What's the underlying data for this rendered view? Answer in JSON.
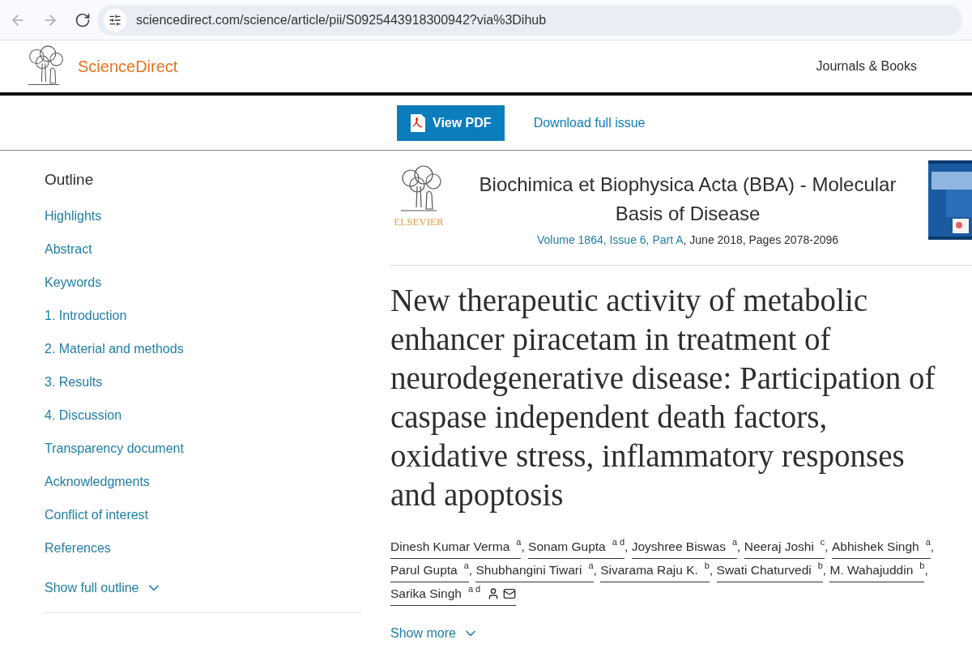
{
  "browser": {
    "url": "sciencedirect.com/science/article/pii/S0925443918300942?via%3Dihub"
  },
  "header": {
    "logo_text": "ScienceDirect",
    "nav": "Journals & Books"
  },
  "toolbar": {
    "pdf_button": "View PDF",
    "download": "Download full issue"
  },
  "outline": {
    "title": "Outline",
    "items": [
      "Highlights",
      "Abstract",
      "Keywords",
      "1. Introduction",
      "2. Material and methods",
      "3. Results",
      "4. Discussion",
      "Transparency document",
      "Acknowledgments",
      "Conflict of interest",
      "References"
    ],
    "show_full": "Show full outline"
  },
  "journal": {
    "publisher": "ELSEVIER",
    "title": "Biochimica et Biophysica Acta (BBA) - Molecular Basis of Disease",
    "issue_link": "Volume 1864, Issue 6, Part A",
    "issue_rest": ", June 2018, Pages 2078-2096"
  },
  "article": {
    "title_lines": [
      "New therapeutic activity of metabolic",
      "enhancer piracetam in treatment of",
      "neurodegenerative disease: Participation of",
      "caspase independent death factors,",
      "oxidative stress, inflammatory responses",
      "and apoptosis"
    ],
    "authors": [
      {
        "name": "Dinesh Kumar Verma",
        "aff": "a",
        "sep": ","
      },
      {
        "name": "Sonam Gupta",
        "aff": "a d",
        "sep": ","
      },
      {
        "name": "Joyshree Biswas",
        "aff": "a",
        "sep": ","
      },
      {
        "name": "Neeraj Joshi",
        "aff": "c",
        "sep": ","
      },
      {
        "name": "Abhishek Singh",
        "aff": "a",
        "sep": ","
      },
      {
        "name": "Parul Gupta",
        "aff": "a",
        "sep": ","
      },
      {
        "name": "Shubhangini Tiwari",
        "aff": "a",
        "sep": ","
      },
      {
        "name": "Sivarama Raju K.",
        "aff": "b",
        "sep": ","
      },
      {
        "name": "Swati Chaturvedi",
        "aff": "b",
        "sep": ","
      },
      {
        "name": "M. Wahajuddin",
        "aff": "b",
        "sep": ","
      },
      {
        "name": "Sarika Singh",
        "aff": "a d",
        "corresponding": true
      }
    ],
    "show_more": "Show more"
  }
}
